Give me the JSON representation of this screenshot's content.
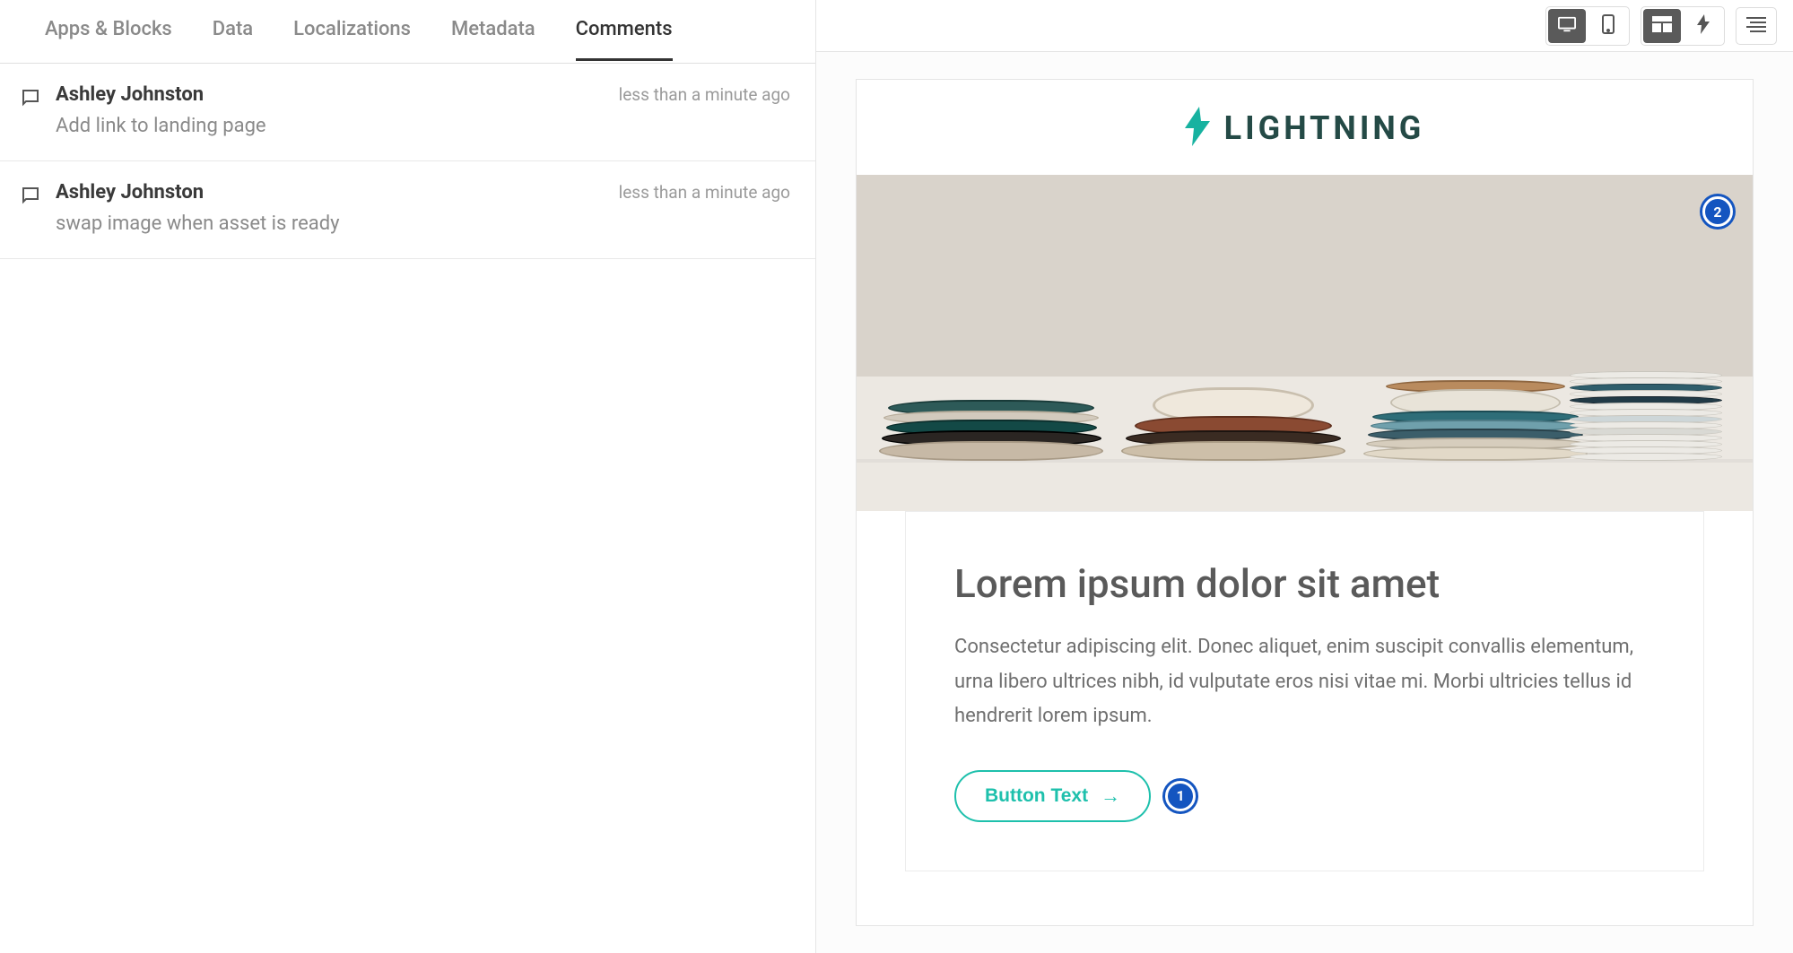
{
  "tabs": {
    "apps_blocks": "Apps & Blocks",
    "data": "Data",
    "localizations": "Localizations",
    "metadata": "Metadata",
    "comments": "Comments",
    "active": "comments"
  },
  "comments": [
    {
      "author": "Ashley Johnston",
      "time": "less than a minute ago",
      "text": "Add link to landing page"
    },
    {
      "author": "Ashley Johnston",
      "time": "less than a minute ago",
      "text": "swap image when asset is ready"
    }
  ],
  "toolbar": {
    "desktop_icon": "desktop",
    "mobile_icon": "mobile",
    "layout_icon": "layout",
    "bolt_icon": "bolt",
    "outline_icon": "outline"
  },
  "preview": {
    "brand": "LIGHTNING",
    "hero_pin": "2",
    "headline": "Lorem ipsum dolor sit amet",
    "body": "Consectetur adipiscing elit. Donec aliquet, enim suscipit convallis elementum, urna libero ultrices nibh, id vulputate eros nisi vitae mi. Morbi ultricies tellus id hendrerit lorem ipsum.",
    "button_label": "Button Text",
    "button_arrow": "→",
    "button_pin": "1"
  },
  "colors": {
    "accent": "#1ec0ac",
    "brand_text": "#244a46",
    "pin": "#1455c0"
  }
}
